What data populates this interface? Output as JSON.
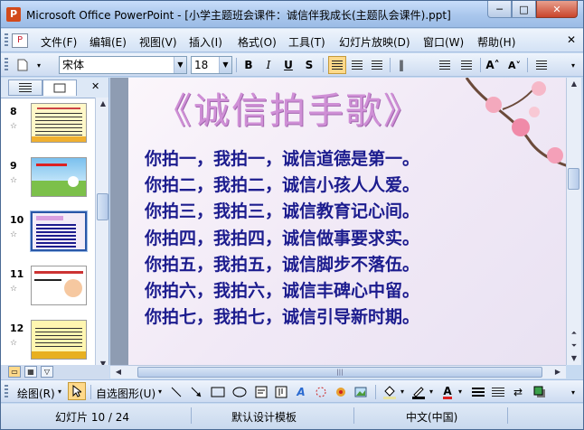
{
  "window": {
    "title": "Microsoft Office PowerPoint - [小学主题班会课件：诚信伴我成长(主题队会课件).ppt]",
    "app_icon_letter": "P",
    "minimize": "─",
    "maximize": "□",
    "close": "✕"
  },
  "menu": {
    "items": [
      "文件(F)",
      "编辑(E)",
      "视图(V)",
      "插入(I)",
      "格式(O)",
      "工具(T)",
      "幻灯片放映(D)",
      "窗口(W)",
      "帮助(H)"
    ],
    "close_doc": "✕"
  },
  "format_toolbar": {
    "font_name": "宋体",
    "font_size": "18",
    "bold": "B",
    "italic": "I",
    "underline": "U",
    "shadow": "S",
    "increase_font": "A˄",
    "decrease_font": "A˅",
    "align_left_active": true
  },
  "left_pane": {
    "close": "✕",
    "slides": [
      {
        "number": "8"
      },
      {
        "number": "9"
      },
      {
        "number": "10",
        "selected": true
      },
      {
        "number": "11"
      },
      {
        "number": "12"
      }
    ],
    "star": "☆"
  },
  "slide": {
    "title": "《诚信拍手歌》",
    "lines": [
      "你拍一，我拍一，诚信道德是第一。",
      "你拍二，我拍二，诚信小孩人人爱。",
      "你拍三，我拍三，诚信教育记心间。",
      "你拍四，我拍四，诚信做事要求实。",
      "你拍五，我拍五，诚信脚步不落伍。",
      "你拍六，我拍六，诚信丰碑心中留。",
      "你拍七，我拍七，诚信引导新时期。"
    ]
  },
  "draw_toolbar": {
    "draw": "绘图(R)",
    "autoshapes": "自选图形(U)"
  },
  "status": {
    "slide_position": "幻灯片 10 / 24",
    "template": "默认设计模板",
    "language": "中文(中国)"
  },
  "colors": {
    "title_color": "#cf8fd6",
    "text_color": "#1c1c8e",
    "chrome": "#c6daf1"
  }
}
